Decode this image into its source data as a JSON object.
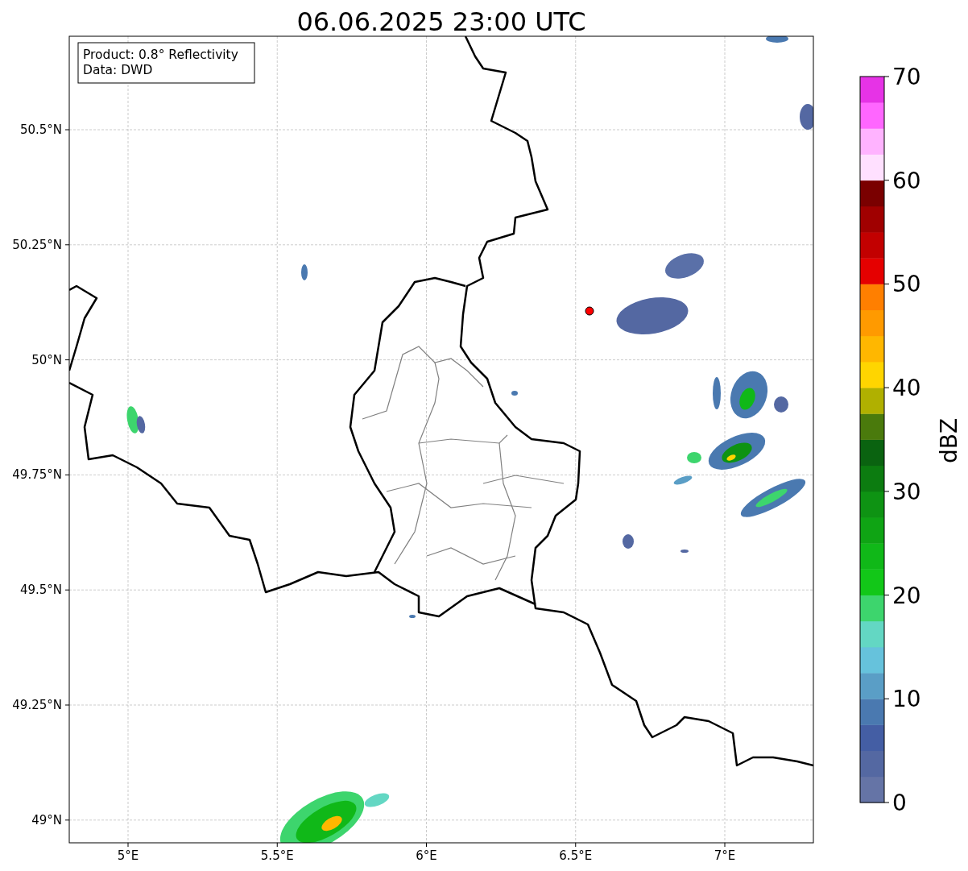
{
  "title": "06.06.2025 23:00 UTC",
  "legend": [
    "Product: 0.8° Reflectivity",
    "Data: DWD"
  ],
  "map": {
    "lon_ticks": [
      "5°E",
      "5.5°E",
      "6°E",
      "6.5°E",
      "7°E"
    ],
    "lat_ticks": [
      "50.5°N",
      "50.25°N",
      "50°N",
      "49.75°N",
      "49.5°N",
      "49.25°N",
      "49°N"
    ]
  },
  "colorbar": {
    "label": "dBZ",
    "ticks": [
      "70",
      "60",
      "50",
      "40",
      "30",
      "20",
      "10",
      "0"
    ],
    "bands": [
      {
        "color": "#6574a6"
      },
      {
        "color": "#5468a2"
      },
      {
        "color": "#445ea4"
      },
      {
        "color": "#4a79b0"
      },
      {
        "color": "#5a9ec6"
      },
      {
        "color": "#66c2dc"
      },
      {
        "color": "#63d7c3"
      },
      {
        "color": "#3dd56d"
      },
      {
        "color": "#12c718"
      },
      {
        "color": "#10b818"
      },
      {
        "color": "#0fa414"
      },
      {
        "color": "#0e9313"
      },
      {
        "color": "#0c7c10"
      },
      {
        "color": "#0a6310"
      },
      {
        "color": "#4a7a0c"
      },
      {
        "color": "#b0b000"
      },
      {
        "color": "#ffd500"
      },
      {
        "color": "#ffb700"
      },
      {
        "color": "#ff9a00"
      },
      {
        "color": "#ff7f00"
      },
      {
        "color": "#e50000"
      },
      {
        "color": "#c20000"
      },
      {
        "color": "#a00000"
      },
      {
        "color": "#7a0000"
      },
      {
        "color": "#ffe0ff"
      },
      {
        "color": "#ffb3ff"
      },
      {
        "color": "#ff66ff"
      },
      {
        "color": "#e633e6"
      }
    ]
  }
}
